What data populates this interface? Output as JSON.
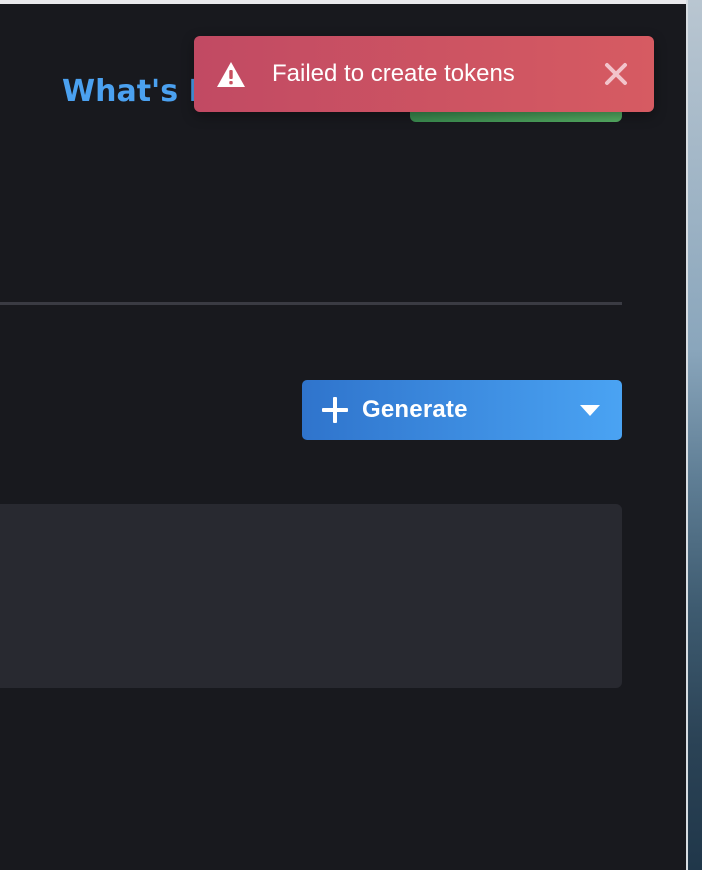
{
  "header": {
    "whats_new_label": "What's N"
  },
  "actions": {
    "generate_label": "Generate"
  },
  "toast": {
    "message": "Failed to create tokens",
    "type": "error"
  },
  "icons": {
    "warning": "warning-icon",
    "close": "close-icon",
    "plus": "plus-icon",
    "caret": "caret-down-icon"
  },
  "colors": {
    "background": "#18191e",
    "link": "#4ba1f0",
    "primary_button": "#3b8ee0",
    "success_button": "#4a9e5a",
    "toast_error": "#cc525f",
    "panel": "#282930"
  }
}
